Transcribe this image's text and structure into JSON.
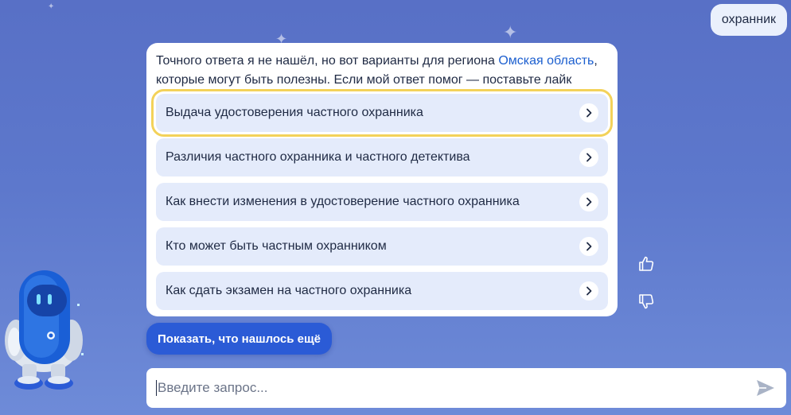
{
  "user_message": "охранник",
  "answer": {
    "text_before_region": "Точного ответа я не нашёл, но вот варианты для региона ",
    "region": "Омская область",
    "text_after_region": ", которые могут быть полезны. Если мой ответ помог — поставьте лайк"
  },
  "options": [
    {
      "label": "Выдача удостоверения частного охранника"
    },
    {
      "label": "Различия частного охранника и частного детектива"
    },
    {
      "label": "Как внести изменения в удостоверение частного охранника"
    },
    {
      "label": "Кто может быть частным охранником"
    },
    {
      "label": "Как сдать экзамен на частного охранника"
    }
  ],
  "more_button": "Показать, что нашлось ещё",
  "input": {
    "value": "",
    "placeholder": "Введите запрос..."
  },
  "icons": {
    "like": "thumbs-up-icon",
    "dislike": "thumbs-down-icon",
    "send": "send-icon",
    "option_arrow": "chevron-right-icon"
  },
  "colors": {
    "accent": "#2b5bd6",
    "link": "#1c5fcf",
    "focus": "#f3d25a"
  }
}
